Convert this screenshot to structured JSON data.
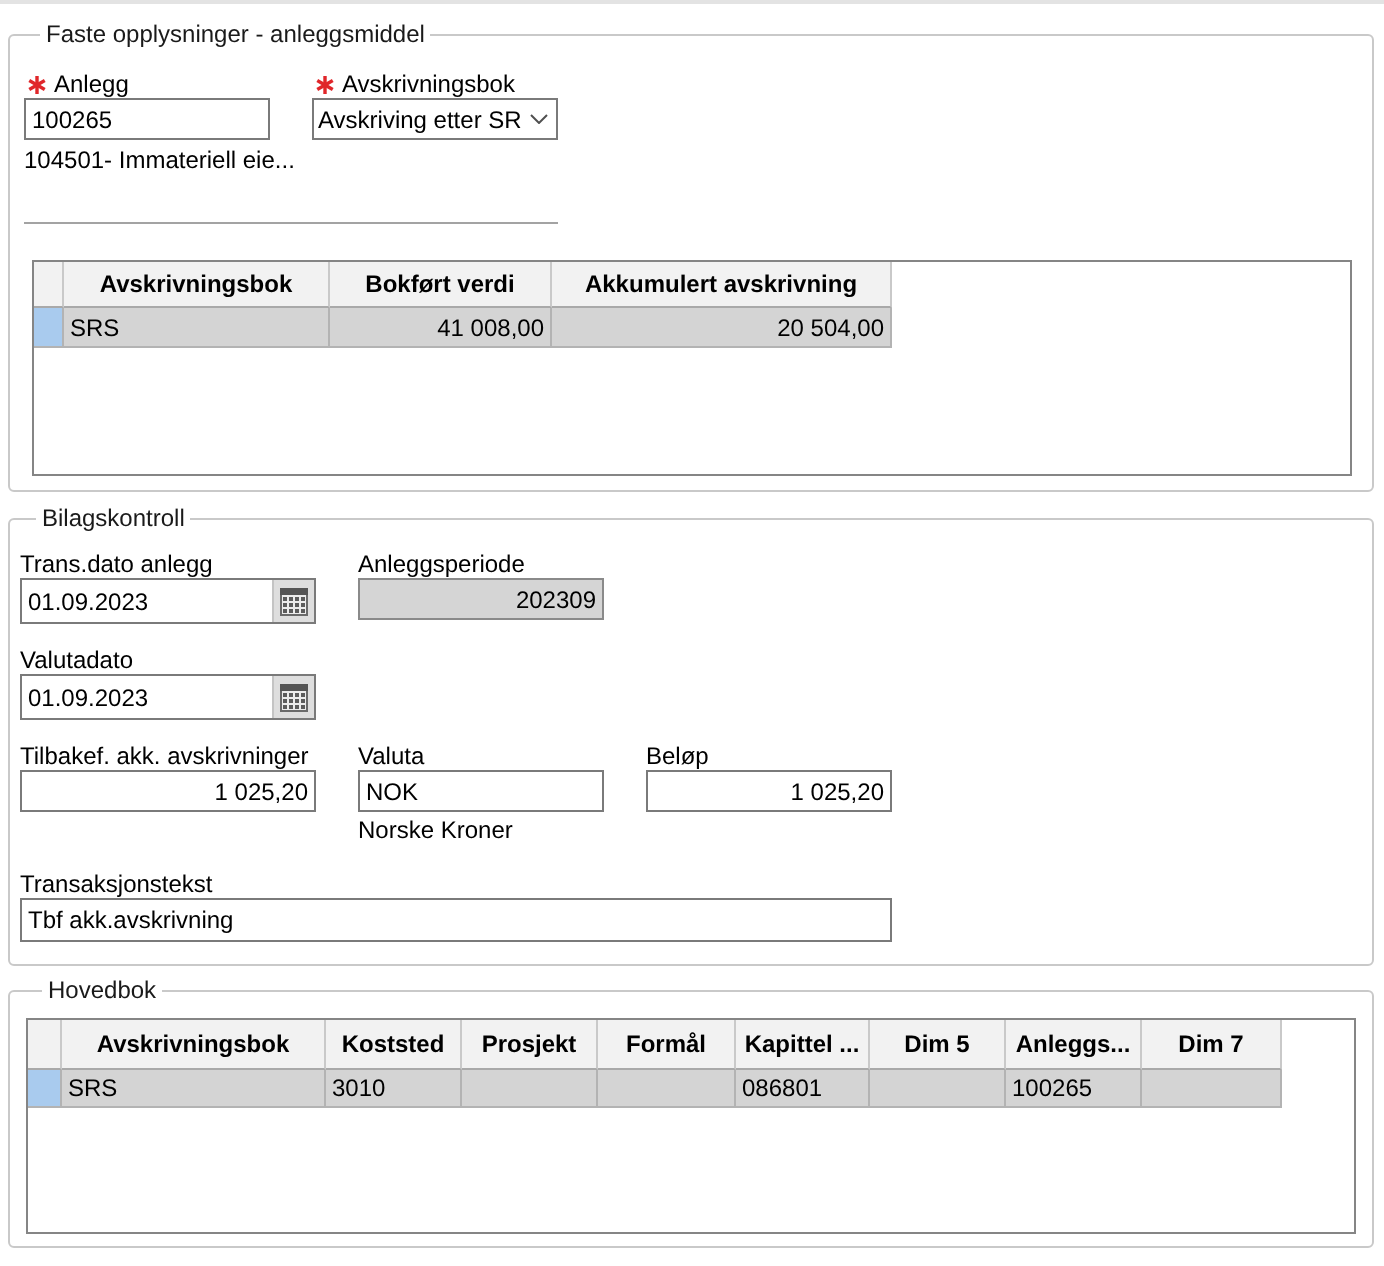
{
  "asset_info": {
    "title": "Faste opplysninger - anleggsmiddel",
    "fields": [
      {
        "kind": "text",
        "label": "Anlegg",
        "required": true,
        "value": "100265",
        "note": "104501- Immateriell eie..."
      },
      {
        "kind": "dropdown",
        "label": "Avskrivningsbok",
        "required": true,
        "value": "Avskriving etter SR"
      }
    ],
    "table": {
      "columns": [
        "Avskrivningsbok",
        "Bokført verdi",
        "Akkumulert avskrivning"
      ],
      "rows": [
        {
          "selected": true,
          "cells": [
            "SRS",
            "41 008,00",
            "20 504,00"
          ]
        }
      ]
    }
  },
  "voucher_check": {
    "title": "Bilagskontroll",
    "rows": [
      {
        "fields": [
          {
            "kind": "date",
            "label": "Trans.dato anlegg",
            "value": "01.09.2023"
          },
          {
            "kind": "readonly",
            "label": "Anleggsperiode",
            "value": "202309"
          }
        ]
      },
      {
        "fields": [
          {
            "kind": "date",
            "label": "Valutadato",
            "value": "01.09.2023"
          }
        ]
      },
      {
        "fields": [
          {
            "kind": "number",
            "label": "Tilbakef. akk. avskrivninger",
            "value": "1 025,20"
          },
          {
            "kind": "text",
            "label": "Valuta",
            "value": "NOK",
            "note": "Norske Kroner"
          },
          {
            "kind": "number",
            "label": "Beløp",
            "value": "1 025,20"
          }
        ]
      },
      {
        "fields": [
          {
            "kind": "longtext",
            "label": "Transaksjonstekst",
            "value": "Tbf akk.avskrivning"
          }
        ]
      }
    ]
  },
  "general_ledger": {
    "title": "Hovedbok",
    "table": {
      "columns": [
        "Avskrivningsbok",
        "Koststed",
        "Prosjekt",
        "Formål",
        "Kapittel ...",
        "Dim 5",
        "Anleggs...",
        "Dim 7"
      ],
      "rows": [
        {
          "selected": true,
          "cells": [
            "SRS",
            "3010",
            null,
            null,
            "086801",
            null,
            "100265",
            null
          ]
        }
      ]
    }
  }
}
